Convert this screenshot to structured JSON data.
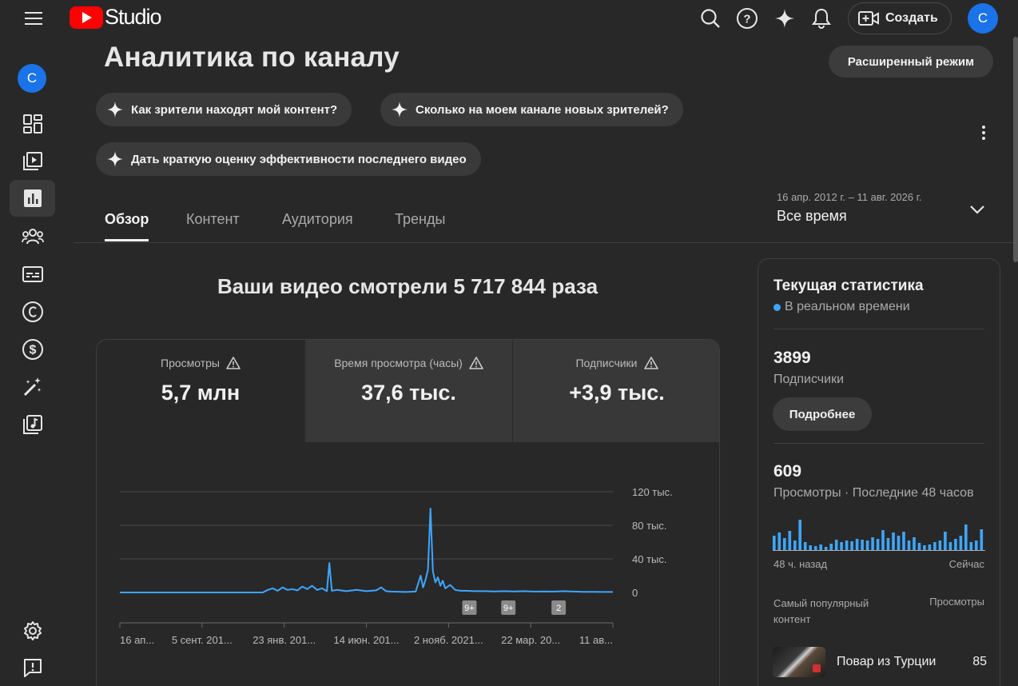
{
  "app": {
    "logo_text": "Studio",
    "create_label": "Создать",
    "avatar_letter": "С",
    "accent_color": "#3ea6ff",
    "brand_color": "#ff0000"
  },
  "sidebar": {
    "avatar_letter": "С",
    "items": [
      {
        "name": "dashboard",
        "icon": "dashboard-icon"
      },
      {
        "name": "content",
        "icon": "video-library-icon"
      },
      {
        "name": "analytics",
        "icon": "analytics-icon",
        "active": true
      },
      {
        "name": "community",
        "icon": "people-icon"
      },
      {
        "name": "subtitles",
        "icon": "subtitles-icon"
      },
      {
        "name": "copyright",
        "icon": "copyright-icon"
      },
      {
        "name": "earn",
        "icon": "dollar-icon"
      },
      {
        "name": "customization",
        "icon": "magic-wand-icon"
      },
      {
        "name": "audio-library",
        "icon": "audio-library-icon"
      },
      {
        "name": "settings",
        "icon": "gear-icon"
      },
      {
        "name": "feedback",
        "icon": "feedback-icon"
      }
    ]
  },
  "header": {
    "title": "Аналитика по каналу",
    "advanced_mode": "Расширенный режим"
  },
  "chips": [
    "Как зрители находят мой контент?",
    "Сколько на моем канале новых зрителей?",
    "Дать краткую оценку эффективности последнего видео"
  ],
  "tabs": [
    "Обзор",
    "Контент",
    "Аудитория",
    "Тренды"
  ],
  "date_range": {
    "dates": "16 апр. 2012 г. – 11 авг. 2026 г.",
    "label": "Все время"
  },
  "summary": {
    "headline": "Ваши видео смотрели 5 717 844 раза"
  },
  "metrics": [
    {
      "label": "Просмотры",
      "value": "5,7 млн"
    },
    {
      "label": "Время просмотра (часы)",
      "value": "37,6 тыс."
    },
    {
      "label": "Подписчики",
      "value": "+3,9 тыс."
    }
  ],
  "chart_data": {
    "type": "line",
    "y_tick_labels": [
      "120 тыс.",
      "80 тыс.",
      "40 тыс.",
      "0"
    ],
    "ylim": [
      0,
      120000
    ],
    "x_tick_labels": [
      "16 ап...",
      "5 сент. 201...",
      "23 янв. 201...",
      "14 июн. 201...",
      "2 нояб. 2021...",
      "22 мар. 20...",
      "11 ав..."
    ],
    "markers": [
      "9+",
      "9+",
      "2"
    ],
    "series": [
      {
        "color": "#3ea6ff",
        "x": [
          0,
          0.29,
          0.3,
          0.31,
          0.32,
          0.33,
          0.34,
          0.35,
          0.36,
          0.37,
          0.38,
          0.39,
          0.4,
          0.41,
          0.42,
          0.425,
          0.43,
          0.44,
          0.46,
          0.48,
          0.5,
          0.52,
          0.53,
          0.54,
          0.55,
          0.57,
          0.58,
          0.6,
          0.61,
          0.615,
          0.62,
          0.625,
          0.63,
          0.635,
          0.64,
          0.645,
          0.65,
          0.655,
          0.66,
          0.67,
          0.68,
          0.69,
          0.7,
          0.72,
          0.74,
          0.76,
          0.78,
          0.8,
          0.82,
          0.84,
          0.86,
          0.88,
          0.9,
          0.92,
          0.94,
          0.96,
          0.98,
          1.0
        ],
        "y": [
          0,
          0,
          3000,
          5000,
          2000,
          6000,
          3000,
          4000,
          2500,
          7000,
          4000,
          8000,
          3000,
          5000,
          1500,
          35000,
          2000,
          3000,
          1500,
          3000,
          1500,
          2500,
          6000,
          1500,
          1000,
          800,
          600,
          1000,
          20000,
          6000,
          15000,
          27000,
          100000,
          25000,
          12000,
          18000,
          8000,
          14000,
          5000,
          9000,
          3000,
          2000,
          2000,
          1500,
          1500,
          1200,
          1500,
          1200,
          1500,
          1000,
          1200,
          1000,
          1500,
          1000,
          800,
          800,
          600,
          600
        ]
      }
    ]
  },
  "realtime": {
    "title": "Текущая статистика",
    "realtime_label": "В реальном времени",
    "subscribers_value": "3899",
    "subscribers_label": "Подписчики",
    "details_button": "Подробнее",
    "views_value": "609",
    "views_label": "Просмотры · Последние 48 часов",
    "bars_start_label": "48 ч. назад",
    "bars_end_label": "Сейчас",
    "bars": [
      18,
      22,
      15,
      24,
      12,
      38,
      10,
      6,
      5,
      7,
      4,
      8,
      13,
      10,
      12,
      11,
      14,
      13,
      12,
      16,
      14,
      25,
      15,
      22,
      18,
      23,
      12,
      16,
      9,
      6,
      7,
      10,
      12,
      23,
      10,
      14,
      18,
      32,
      10,
      12,
      26
    ],
    "top_content_label": "Самый популярный контент",
    "top_views_label": "Просмотры",
    "top_video_title": "Повар из Турции",
    "top_video_views": "85"
  }
}
